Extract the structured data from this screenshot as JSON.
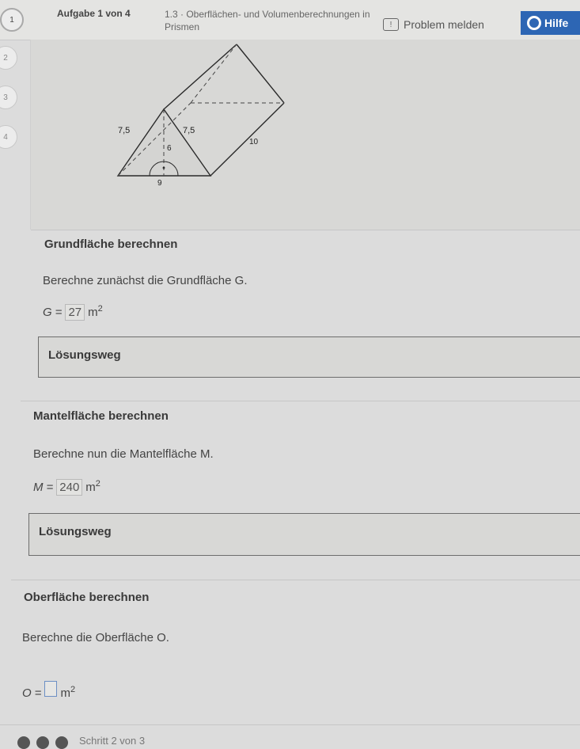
{
  "steps": [
    "1",
    "2",
    "3",
    "4"
  ],
  "header": {
    "task": "Aufgabe 1 von 4",
    "section": "1.3 · Oberflächen- und Volumenberechnungen in Prismen",
    "problem_label": "Problem melden",
    "help_label": "Hilfe"
  },
  "figure": {
    "side_left": "7,5",
    "side_right": "7,5",
    "height": "6",
    "base": "9",
    "length": "10"
  },
  "sections": [
    {
      "title": "Grundfläche berechnen",
      "text": "Berechne zunächst die Grundfläche G.",
      "var": "G",
      "value": "27",
      "unit": "m",
      "exp": "2",
      "button": "Lösungsweg"
    },
    {
      "title": "Mantelfläche berechnen",
      "text": "Berechne nun die Mantelfläche M.",
      "var": "M",
      "value": "240",
      "unit": "m",
      "exp": "2",
      "button": "Lösungsweg"
    },
    {
      "title": "Oberfläche berechnen",
      "text": "Berechne die Oberfläche O.",
      "var": "O",
      "value": "",
      "unit": "m",
      "exp": "2"
    }
  ],
  "footer": {
    "step_text": "Schritt 2 von 3"
  }
}
